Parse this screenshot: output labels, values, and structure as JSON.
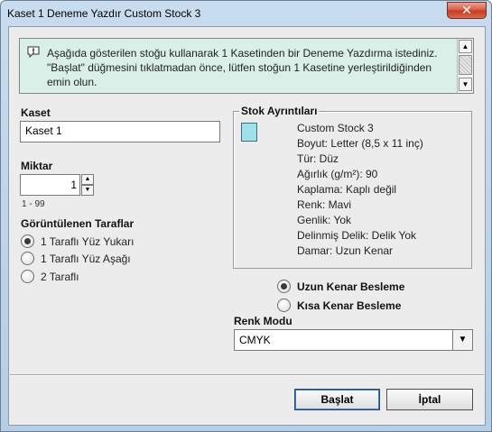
{
  "window": {
    "title": "Kaset 1 Deneme Yazdır Custom Stock 3",
    "close_label": "✕"
  },
  "message": {
    "icon": "speech-bubble-icon",
    "text": "Aşağıda gösterilen stoğu kullanarak 1 Kasetinden bir Deneme Yazdırma istediniz.  \"Başlat\" düğmesini tıklatmadan önce, lütfen stoğun 1 Kasetine yerleştirildiğinden emin olun."
  },
  "tray": {
    "label": "Kaset",
    "value": "Kaset 1"
  },
  "quantity": {
    "label": "Miktar",
    "value": "1",
    "range": "1 - 99"
  },
  "sides": {
    "label": "Görüntülenen Taraflar",
    "options": [
      {
        "label": "1 Taraflı Yüz Yukarı",
        "selected": true
      },
      {
        "label": "1 Taraflı Yüz Aşağı",
        "selected": false
      },
      {
        "label": "2 Taraflı",
        "selected": false
      }
    ]
  },
  "stock_details": {
    "label": "Stok Ayrıntıları",
    "swatch_color": "#9fe0ec",
    "name": "Custom Stock 3",
    "size": "Boyut: Letter (8,5 x 11 inç)",
    "type": "Tür: Düz",
    "weight": "Ağırlık (g/m²): 90",
    "coating": "Kaplama: Kaplı değil",
    "color": "Renk: Mavi",
    "width": "Genlik: Yok",
    "punch": "Delinmiş Delik: Delik Yok",
    "grain": "Damar: Uzun Kenar"
  },
  "feed": {
    "options": [
      {
        "label": "Uzun Kenar Besleme",
        "selected": true
      },
      {
        "label": "Kısa Kenar Besleme",
        "selected": false
      }
    ]
  },
  "color_mode": {
    "label": "Renk Modu",
    "value": "CMYK"
  },
  "buttons": {
    "start": "Başlat",
    "cancel": "İptal"
  }
}
